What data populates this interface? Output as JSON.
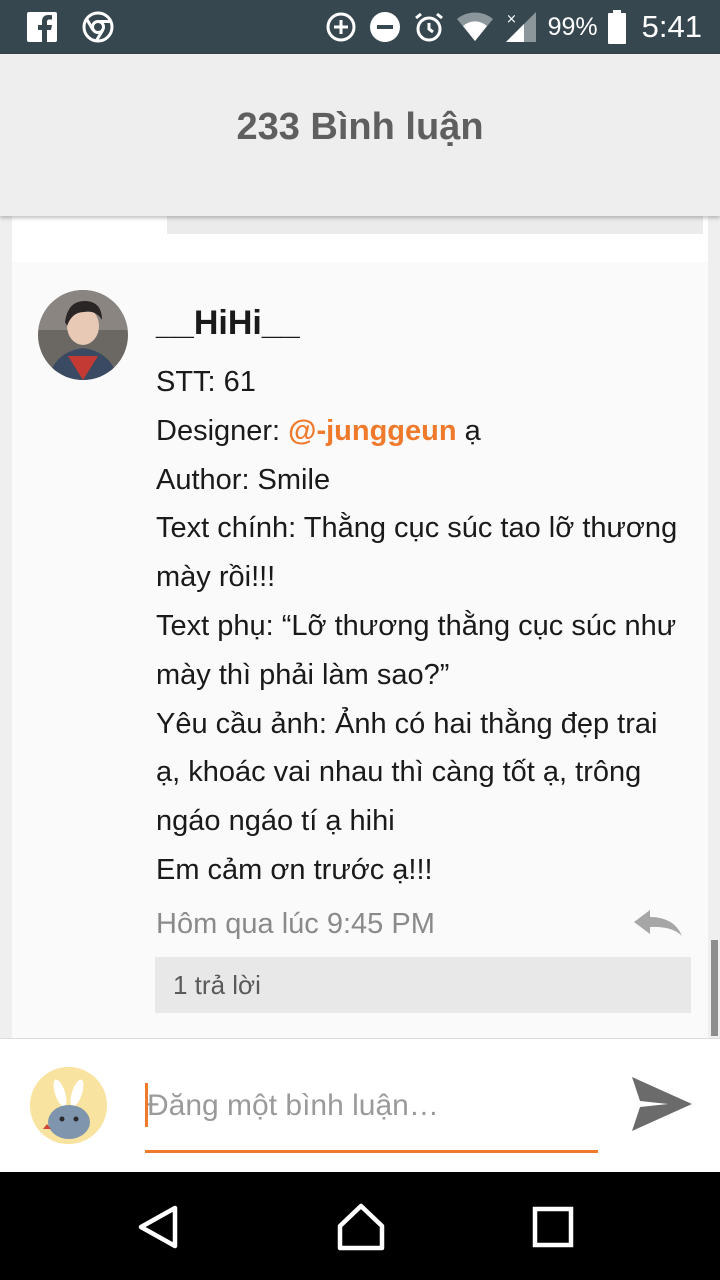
{
  "status_bar": {
    "battery_percent": "99%",
    "time": "5:41",
    "icons": [
      "facebook-icon",
      "chrome-icon",
      "data-saver-icon",
      "do-not-disturb-icon",
      "alarm-icon",
      "wifi-icon",
      "signal-icon",
      "battery-icon"
    ]
  },
  "header": {
    "title": "233 Bình luận"
  },
  "comment": {
    "username": "__HiHi__",
    "stt": "STT: 61",
    "designer_prefix": "Designer: ",
    "designer_mention": "@-junggeun",
    "designer_suffix": " ạ",
    "author": "Author: Smile",
    "text_main": "Text chính: Thằng cục súc tao lỡ thương mày rồi!!!",
    "text_sub": "Text phụ: “Lỡ thương thằng cục súc như mày thì phải làm sao?”",
    "image_request": "Yêu cầu ảnh: Ảnh có hai thằng đẹp trai ạ, khoác vai nhau thì càng tốt ạ, trông ngáo ngáo tí ạ hihi",
    "thanks": "Em cảm ơn trước ạ!!!",
    "timestamp": "Hôm qua lúc 9:45 PM",
    "replies_label": "1 trả lời"
  },
  "composer": {
    "placeholder": "Đăng một bình luận…"
  },
  "colors": {
    "status_bar": "#36474f",
    "accent": "#f07a2c",
    "header_bg": "#eeeeee",
    "nav_bar": "#000000"
  }
}
